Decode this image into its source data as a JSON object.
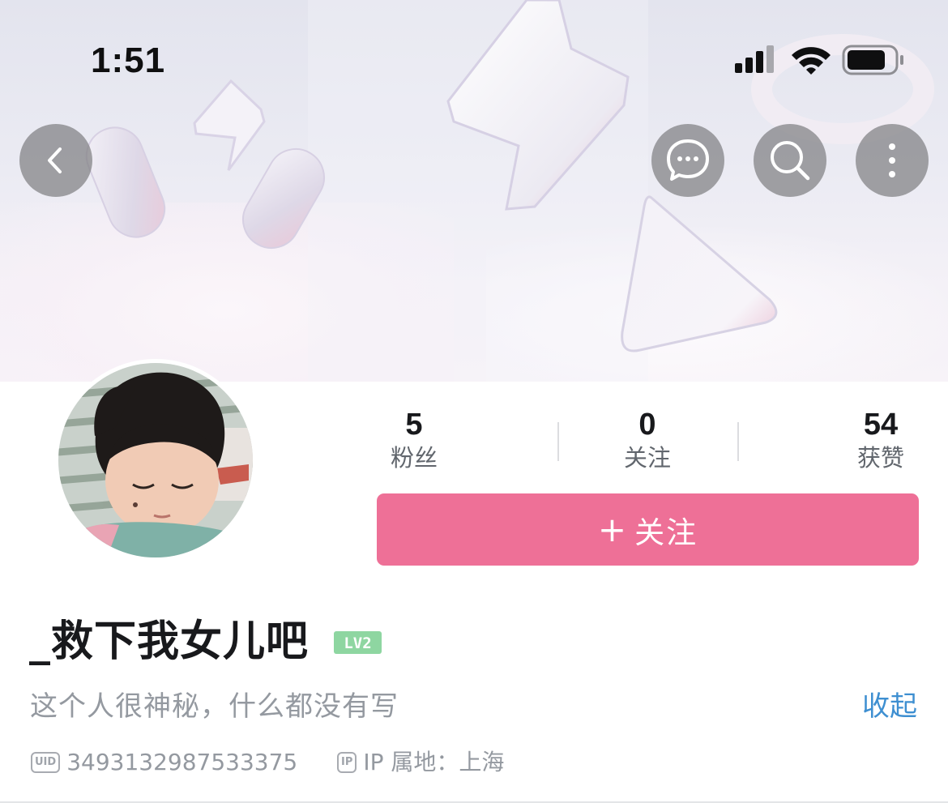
{
  "status_bar": {
    "time": "1:51",
    "icons": [
      "cellular-signal-icon",
      "wifi-icon",
      "battery-icon"
    ]
  },
  "nav": {
    "back_icon": "chevron-left-icon",
    "message_icon": "chat-bubble-icon",
    "search_icon": "search-icon",
    "more_icon": "more-vertical-icon"
  },
  "profile": {
    "stats": [
      {
        "value": "5",
        "label": "粉丝"
      },
      {
        "value": "0",
        "label": "关注"
      },
      {
        "value": "54",
        "label": "获赞"
      }
    ],
    "follow_button": {
      "icon": "+",
      "label": "关注"
    },
    "name": "_救下我女儿吧",
    "level_badge": "LV2",
    "bio": "这个人很神秘，什么都没有写",
    "collapse_label": "收起",
    "uid_tag": "UID",
    "uid": "3493132987533375",
    "ip_tag": "IP",
    "ip_location": "IP 属地：上海"
  },
  "colors": {
    "accent_pink": "#ee7097",
    "link_blue": "#3e8fd1",
    "level_green": "#8ed6a1",
    "nav_button_bg": "#808082"
  }
}
